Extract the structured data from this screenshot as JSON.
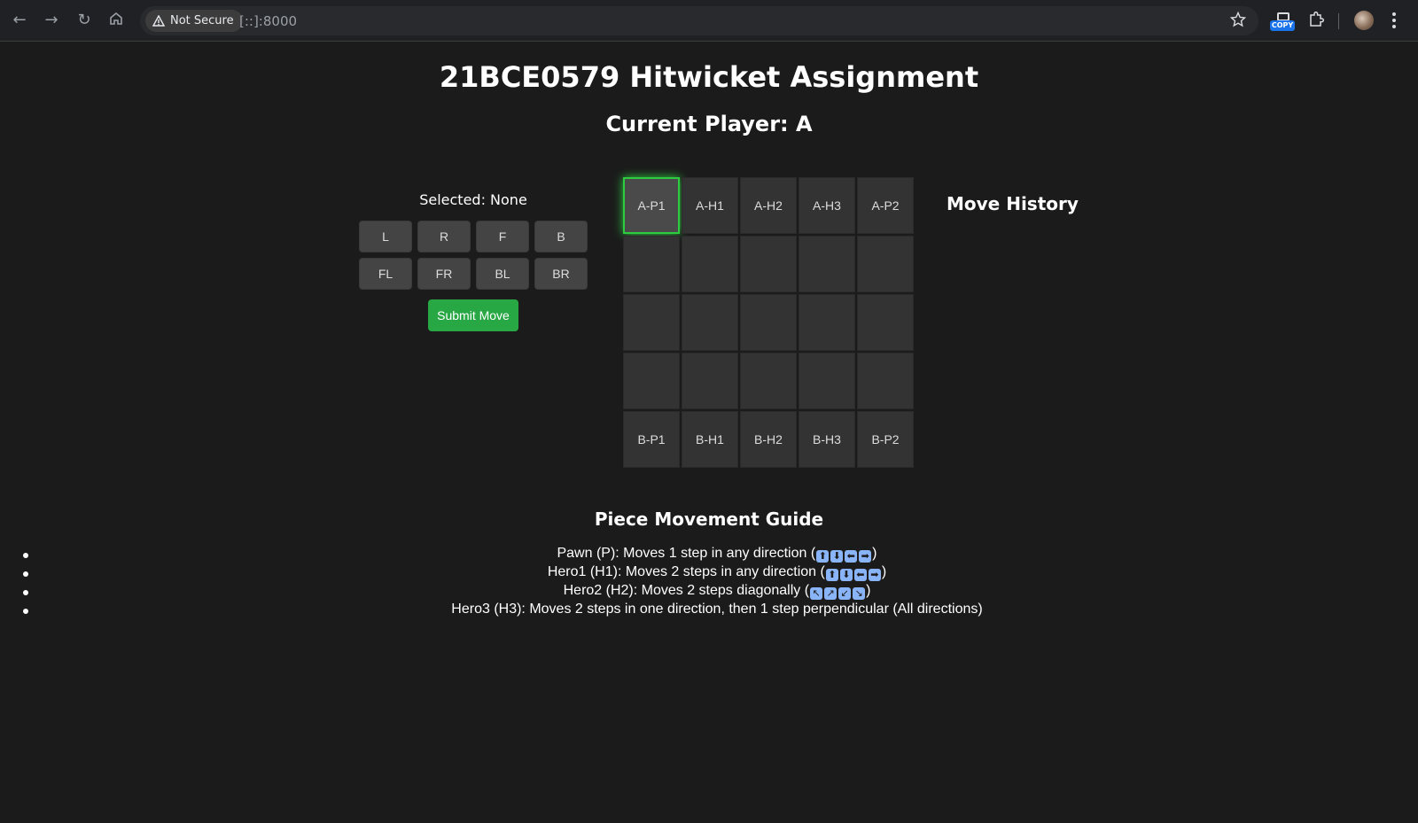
{
  "browser": {
    "security_label": "Not Secure",
    "url": "[::]:8000",
    "copy_ext_label": "COPY"
  },
  "page": {
    "title": "21BCE0579 Hitwicket Assignment",
    "current_player": "Current Player: A",
    "selected": "Selected: None",
    "direction_buttons": [
      "L",
      "R",
      "F",
      "B",
      "FL",
      "FR",
      "BL",
      "BR"
    ],
    "submit_label": "Submit Move",
    "move_history_title": "Move History"
  },
  "board": {
    "rows": [
      [
        "A-P1",
        "A-H1",
        "A-H2",
        "A-H3",
        "A-P2"
      ],
      [
        "",
        "",
        "",
        "",
        ""
      ],
      [
        "",
        "",
        "",
        "",
        ""
      ],
      [
        "",
        "",
        "",
        "",
        ""
      ],
      [
        "B-P1",
        "B-H1",
        "B-H2",
        "B-H3",
        "B-P2"
      ]
    ],
    "selected_cell": "A-P1",
    "highlight_color": "#2ecc40"
  },
  "guide": {
    "title": "Piece Movement Guide",
    "items": [
      {
        "text": "Pawn (P): Moves 1 step in any direction (",
        "arrows": [
          "⬆",
          "⬇",
          "⬅",
          "➡"
        ],
        "end": ")"
      },
      {
        "text": "Hero1 (H1): Moves 2 steps in any direction (",
        "arrows": [
          "⬆",
          "⬇",
          "⬅",
          "➡"
        ],
        "end": ")"
      },
      {
        "text": "Hero2 (H2): Moves 2 steps diagonally (",
        "arrows": [
          "↖",
          "↗",
          "↙",
          "↘"
        ],
        "end": ")"
      },
      {
        "text": "Hero3 (H3): Moves 2 steps in one direction, then 1 step perpendicular (All directions)",
        "arrows": [],
        "end": ""
      }
    ]
  },
  "colors": {
    "background": "#1b1b1b",
    "cell": "#333333",
    "button": "#444444",
    "submit": "#28a745"
  }
}
